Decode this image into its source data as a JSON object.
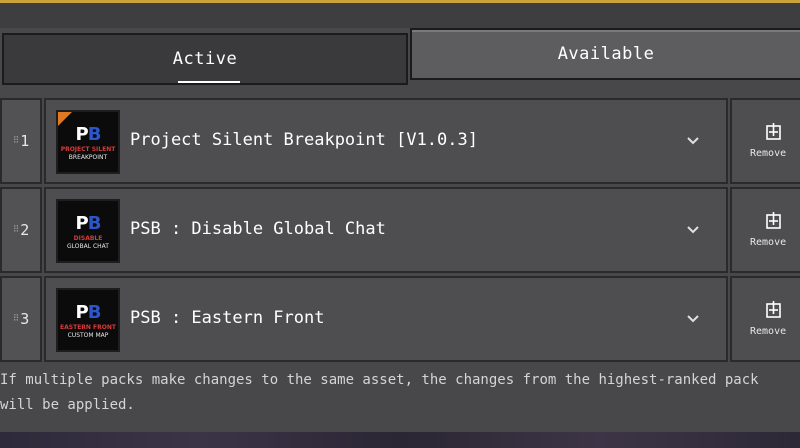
{
  "tabs": {
    "active_label": "Active",
    "available_label": "Available"
  },
  "packs": [
    {
      "rank": "1",
      "title": "Project Silent Breakpoint [V1.0.3]",
      "thumb_line1": "PROJECT SILENT",
      "thumb_line2": "BREAKPOINT",
      "remove_label": "Remove",
      "icon": "remove-pack-icon",
      "badge": "new-corner"
    },
    {
      "rank": "2",
      "title": "PSB : Disable Global Chat",
      "thumb_line1": "DISABLE",
      "thumb_line2": "GLOBAL CHAT",
      "remove_label": "Remove",
      "icon": "remove-pack-icon"
    },
    {
      "rank": "3",
      "title": "PSB : Eastern Front",
      "thumb_line1": "EASTERN FRONT",
      "thumb_line2": "CUSTOM MAP",
      "remove_label": "Remove",
      "icon": "remove-pack-icon"
    }
  ],
  "thumb_logo": {
    "p": "P",
    "b": "B"
  },
  "footer": {
    "note": "If multiple packs make changes to the same asset, the changes from the highest-ranked pack will be applied."
  },
  "colors": {
    "accent": "#c8a43a",
    "thumb_red": "#d93a3a",
    "thumb_blue": "#2c56c9",
    "corner_badge": "#e07a22"
  }
}
